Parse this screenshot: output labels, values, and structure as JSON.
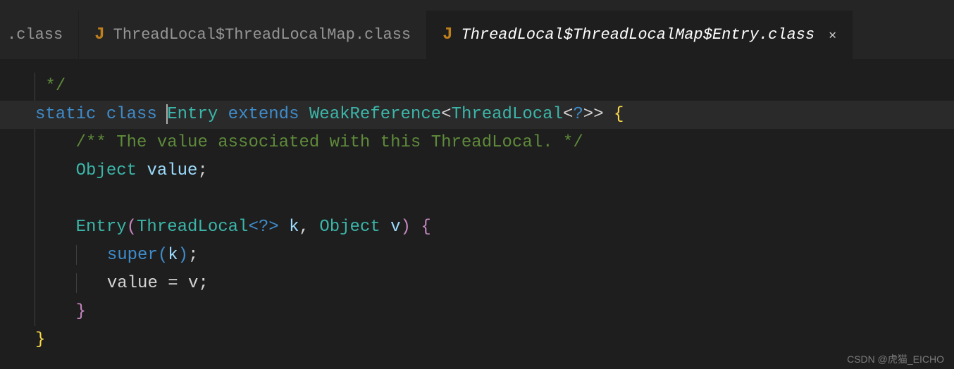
{
  "tabs": {
    "t0_icon": "",
    "t0_label": ".class",
    "t1_icon": "J",
    "t1_label": "ThreadLocal$ThreadLocalMap.class",
    "t2_icon": "J",
    "t2_label": "ThreadLocal$ThreadLocalMap$Entry.class",
    "close": "✕"
  },
  "code": {
    "l1_c1": "*/",
    "l2_kw1": "static",
    "l2_kw2": "class",
    "l2_type1": "Entry",
    "l2_kw3": "extends",
    "l2_type2": "WeakReference",
    "l2_a1": "<",
    "l2_type3": "ThreadLocal",
    "l2_a2": "<",
    "l2_q": "?",
    "l2_a3": ">>",
    "l2_br": " {",
    "l3_c1": "/** The value associated with this ThreadLocal. */",
    "l4_type": "Object",
    "l4_var": "value",
    "l4_semi": ";",
    "l6_ctor": "Entry",
    "l6_p1": "(",
    "l6_t1": "ThreadLocal",
    "l6_a1": "<",
    "l6_q": "?",
    "l6_a2": ">",
    "l6_k": " k",
    "l6_comma": ", ",
    "l6_t2": "Object",
    "l6_v": " v",
    "l6_p2": ")",
    "l6_br": " {",
    "l7_super": "super",
    "l7_p1": "(",
    "l7_k": "k",
    "l7_p2": ")",
    "l7_semi": ";",
    "l8_txt": "value = v;",
    "l9_br": "}",
    "l10_br": "}"
  },
  "watermark": "CSDN @虎猫_EICHO"
}
